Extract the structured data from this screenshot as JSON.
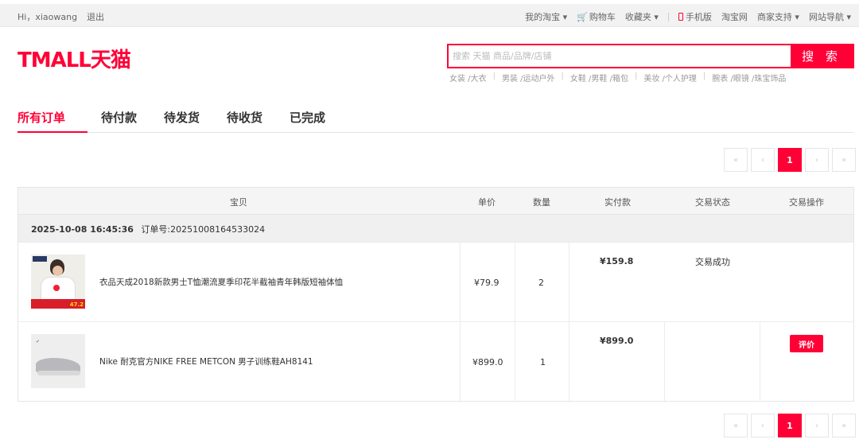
{
  "topbar": {
    "greeting": "Hi，xiaowang",
    "logout": "退出",
    "links": {
      "my_taobao": "我的淘宝",
      "cart": "购物车",
      "favorites": "收藏夹",
      "mobile": "手机版",
      "taobao": "淘宝网",
      "merchant": "商家支持",
      "sitenav": "网站导航"
    }
  },
  "header": {
    "logo_text": "TMALL天猫",
    "search_placeholder": "搜索 天猫 商品/品牌/店铺",
    "search_button": "搜 索",
    "hotwords": [
      "女装 /大衣",
      "男装 /运动户外",
      "女鞋 /男鞋 /箱包",
      "美妆 /个人护理",
      "腕表 /眼镜 /珠宝饰品"
    ]
  },
  "tabs": [
    "所有订单",
    "待付款",
    "待发货",
    "待收货",
    "已完成"
  ],
  "pager": {
    "first": "«",
    "prev": "‹",
    "current": "1",
    "next": "›",
    "last": "»"
  },
  "table": {
    "columns": {
      "item": "宝贝",
      "unit_price": "单价",
      "quantity": "数量",
      "paid": "实付款",
      "status": "交易状态",
      "action": "交易操作"
    },
    "order": {
      "date": "2025-10-08 16:45:36",
      "order_no": "订单号:20251008164533024",
      "items": [
        {
          "title": "衣品天成2018新款男士T恤潮流夏季印花半截袖青年韩版短袖体恤",
          "price": "¥79.9",
          "qty": "2",
          "paid": "¥159.8",
          "image_tag": "47.2"
        },
        {
          "title": "Nike 耐克官方NIKE FREE METCON 男子训练鞋AH8141",
          "price": "¥899.0",
          "qty": "1",
          "paid": "¥899.0",
          "action": "评价"
        }
      ],
      "status": "交易成功"
    }
  },
  "colors": {
    "accent": "#ff0036"
  }
}
